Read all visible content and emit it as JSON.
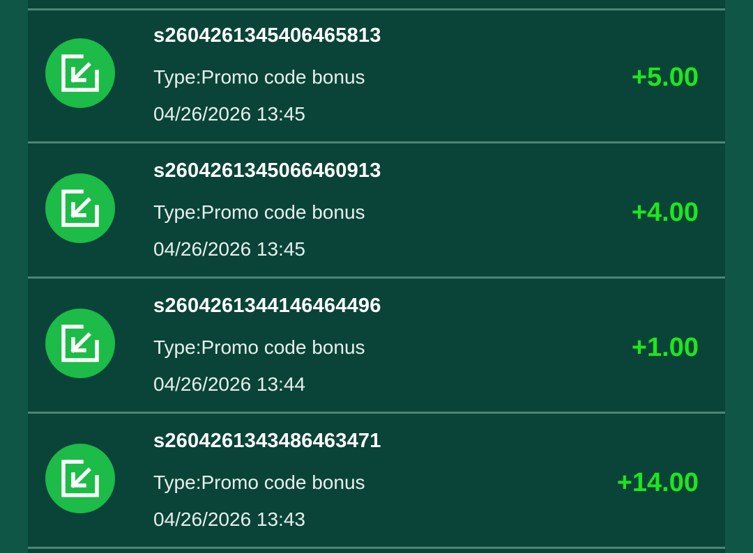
{
  "transactions": [
    {
      "order_id": "s2604261345406465813",
      "type": "Type:Promo code bonus",
      "datetime": "04/26/2026 13:45",
      "amount": "+5.00",
      "icon": "receive-arrow-icon"
    },
    {
      "order_id": "s2604261345066460913",
      "type": "Type:Promo code bonus",
      "datetime": "04/26/2026 13:45",
      "amount": "+4.00",
      "icon": "receive-arrow-icon"
    },
    {
      "order_id": "s2604261344146464496",
      "type": "Type:Promo code bonus",
      "datetime": "04/26/2026 13:44",
      "amount": "+1.00",
      "icon": "receive-arrow-icon"
    },
    {
      "order_id": "s2604261343486463471",
      "type": "Type:Promo code bonus",
      "datetime": "04/26/2026 13:43",
      "amount": "+14.00",
      "icon": "receive-arrow-icon"
    }
  ],
  "colors": {
    "page_background": "#0f5646",
    "card_background": "#0a4438",
    "divider": "#4e8576",
    "icon_circle": "#1dbb47",
    "amount_positive": "#1ee61e",
    "text": "#ffffff"
  }
}
